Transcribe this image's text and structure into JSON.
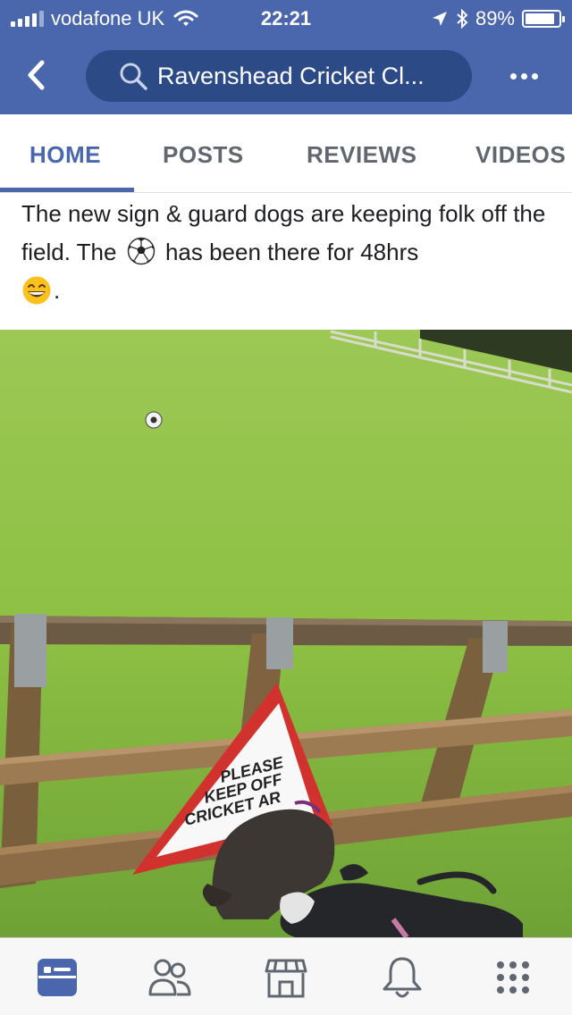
{
  "status_bar": {
    "carrier": "vodafone UK",
    "time": "22:21",
    "battery_percent": "89%",
    "battery_level": 0.89,
    "icons": [
      "signal-icon",
      "wifi-icon",
      "location-arrow-icon",
      "bluetooth-icon",
      "battery-icon"
    ]
  },
  "nav": {
    "back_icon": "chevron-left-icon",
    "search_icon": "search-icon",
    "page_title": "Ravenshead Cricket Cl...",
    "more_icon": "more-dots-icon"
  },
  "tabs": [
    {
      "label": "HOME",
      "active": true
    },
    {
      "label": "POSTS",
      "active": false
    },
    {
      "label": "REVIEWS",
      "active": false
    },
    {
      "label": "VIDEOS",
      "active": false
    }
  ],
  "post": {
    "text_part1": "The new sign & guard dogs are keeping folk off the field. The",
    "text_part2": "has been there for 48hrs",
    "text_part3": ".",
    "emoji_1": "soccer-ball-emoji",
    "emoji_2": "grinning-face-emoji"
  },
  "photo": {
    "sign_line1": "PLEASE",
    "sign_line2": "KEEP OFF",
    "sign_line3": "CRICKET AR"
  },
  "bottom_bar": {
    "items": [
      "news-feed-icon",
      "friends-icon",
      "marketplace-icon",
      "notifications-bell-icon",
      "menu-grid-icon"
    ],
    "active_index": 0,
    "colors": {
      "active": "#4a67ad",
      "inactive": "#606770"
    }
  },
  "colors": {
    "brand": "#4a67ad",
    "search_pill": "#2c4a86"
  }
}
